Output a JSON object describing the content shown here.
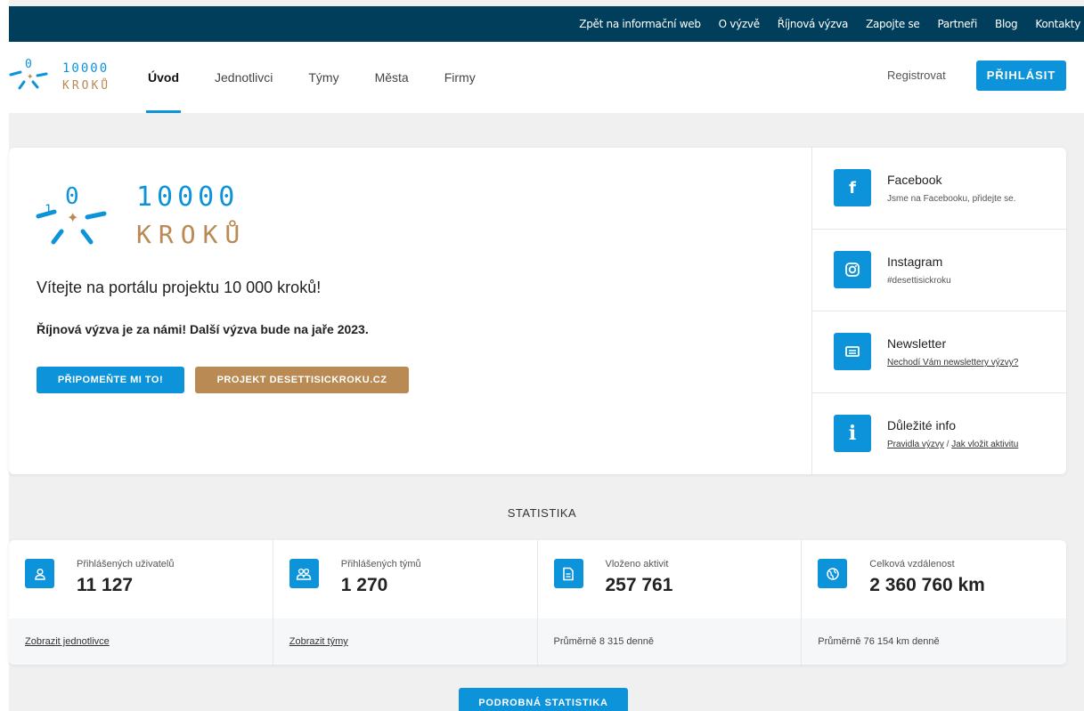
{
  "topnav": [
    "Zpět na informační web",
    "O výzvě",
    "Říjnová výzva",
    "Zapojte se",
    "Partneři",
    "Blog",
    "Kontakty"
  ],
  "logo": {
    "line1": "10000",
    "line2": "KROKŮ",
    "mark_left": "1",
    "mark_top": "0"
  },
  "mainnav": {
    "items": [
      "Úvod",
      "Jednotlivci",
      "Týmy",
      "Města",
      "Firmy"
    ],
    "active": "Úvod"
  },
  "auth": {
    "register": "Registrovat",
    "login": "PŘIHLÁSIT"
  },
  "hero": {
    "welcome": "Vítejte na portálu projektu 10 000 kroků!",
    "message": "Říjnová výzva je za námi! Další výzva bude na jaře 2023.",
    "btn_remind": "PŘIPOMEŇTE MI TO!",
    "btn_project": "PROJEKT DESETTISICKROKU.CZ"
  },
  "side": {
    "facebook": {
      "title": "Facebook",
      "sub": "Jsme na Facebooku, přidejte se."
    },
    "instagram": {
      "title": "Instagram",
      "sub": "#desettisickroku"
    },
    "newsletter": {
      "title": "Newsletter",
      "sub": "Nechodí Vám newslettery výzvy?"
    },
    "info": {
      "title": "Důležité info",
      "link1": "Pravidla výzvy",
      "sep": " / ",
      "link2": "Jak vložit aktivitu"
    }
  },
  "stats": {
    "title": "STATISTIKA",
    "items": [
      {
        "label": "Přihlášených uživatelů",
        "value": "11 127",
        "foot": "Zobrazit jednotlivce"
      },
      {
        "label": "Přihlášených týmů",
        "value": "1 270",
        "foot": "Zobrazit týmy"
      },
      {
        "label": "Vloženo aktivit",
        "value": "257 761",
        "foot": "Průměrně 8 315 denně"
      },
      {
        "label": "Celková vzdálenost",
        "value": "2 360 760 km",
        "foot": "Průměrně 76 154 km denně"
      }
    ],
    "detail_button": "PODROBNÁ STATISTIKA"
  },
  "colors": {
    "primary": "#0d93d9",
    "brown": "#b98a53",
    "topbar": "#003e5c"
  }
}
